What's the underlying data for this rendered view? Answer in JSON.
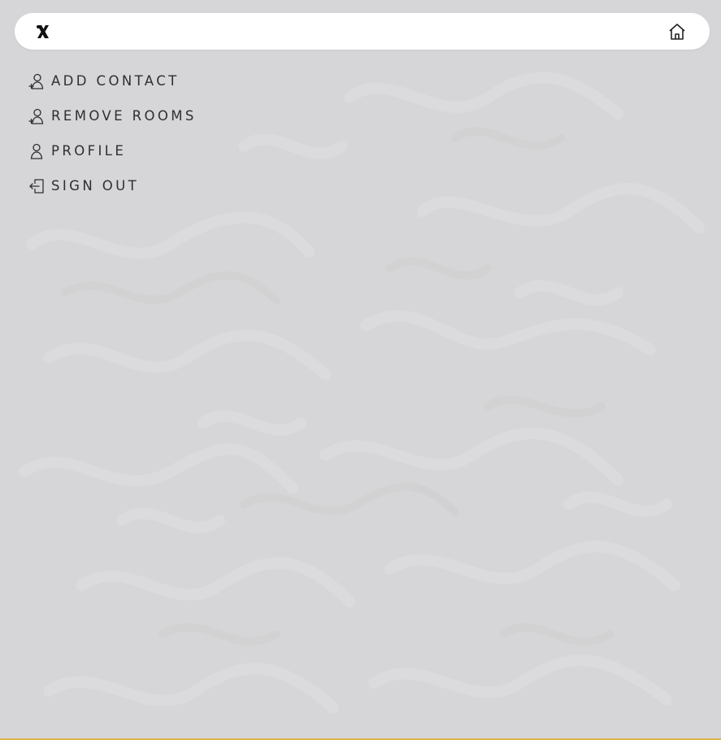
{
  "colors": {
    "background": "#d6d6d8",
    "topbar": "#ffffff",
    "text": "#2f2f31",
    "bottom_accent": "#e0b24a"
  },
  "topbar": {
    "logo_icon": "x-logo-icon",
    "home_icon": "home-icon"
  },
  "menu": {
    "items": [
      {
        "label": "ADD CONTACT",
        "icon": "add-user-icon"
      },
      {
        "label": "REMOVE ROOMS",
        "icon": "add-user-icon"
      },
      {
        "label": "PROFILE",
        "icon": "user-icon"
      },
      {
        "label": "SIGN OUT",
        "icon": "sign-out-icon"
      }
    ]
  }
}
